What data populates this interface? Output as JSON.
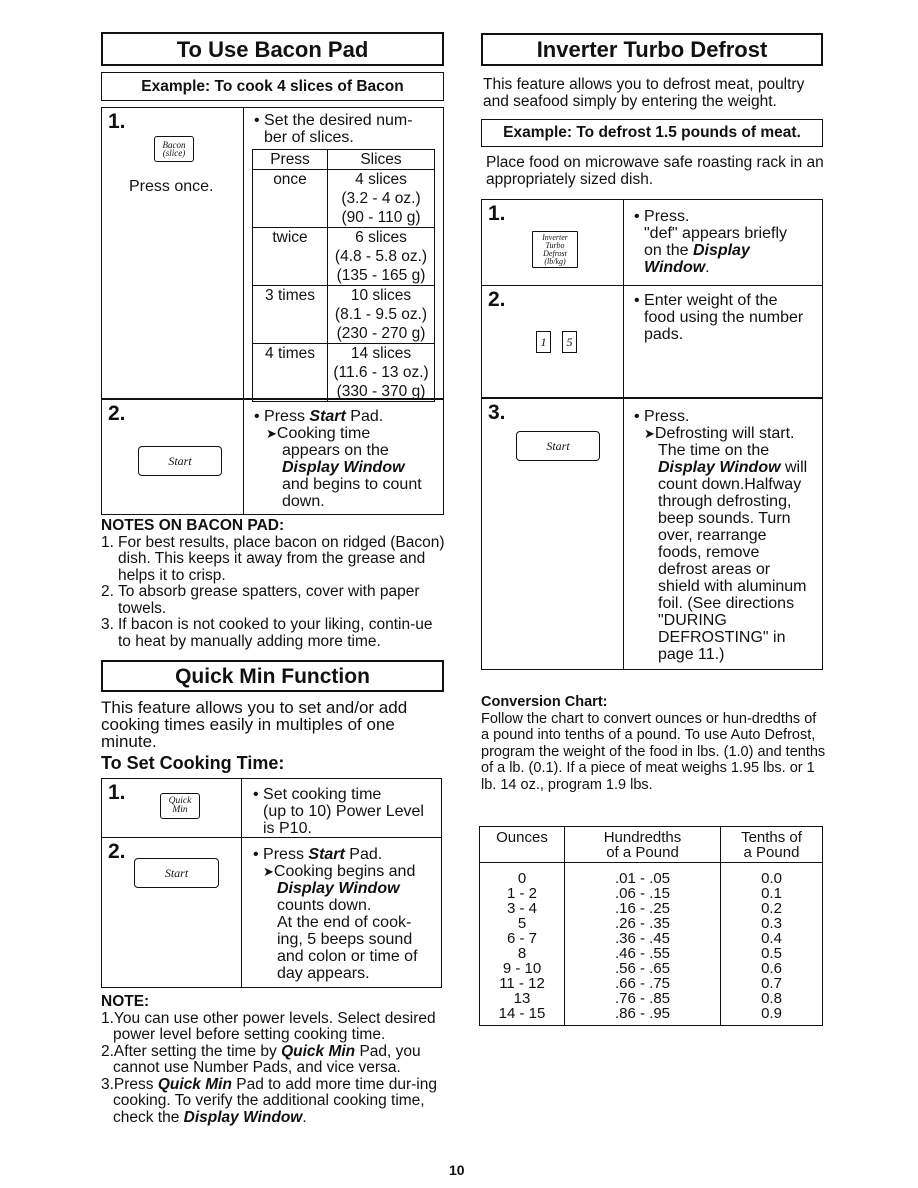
{
  "page_number": "10",
  "bacon": {
    "title": "To Use Bacon Pad",
    "example": "Example:  To cook 4 slices of Bacon",
    "step1": {
      "number": "1.",
      "pad_label_line1": "Bacon",
      "pad_label_line2": "(slice)",
      "press_note": "Press once.",
      "instruction_line1": "• Set the desired num-",
      "instruction_line2": "ber of slices.",
      "table": {
        "headers": [
          "Press",
          "Slices"
        ],
        "rows": [
          {
            "press": "once",
            "slices": "4 slices",
            "oz": "(3.2 - 4 oz.)",
            "g": "(90 - 110 g)"
          },
          {
            "press": "twice",
            "slices": "6 slices",
            "oz": "(4.8 - 5.8 oz.)",
            "g": "(135 - 165 g)"
          },
          {
            "press": "3 times",
            "slices": "10 slices",
            "oz": "(8.1 - 9.5 oz.)",
            "g": "(230 - 270 g)"
          },
          {
            "press": "4 times",
            "slices": "14 slices",
            "oz": "(11.6 - 13 oz.)",
            "g": "(330 - 370 g)"
          }
        ]
      }
    },
    "step2": {
      "number": "2.",
      "pad_label": "Start",
      "line1_pre": "• Press ",
      "line1_bold": "Start",
      "line1_post": " Pad.",
      "arrow": "➤",
      "line2": "Cooking time",
      "line3": "appears on the",
      "line4_bold": "Display Window",
      "line5": "and begins to count",
      "line6": "down."
    },
    "notes": {
      "heading": "NOTES ON BACON PAD:",
      "items": [
        {
          "num": "1.",
          "text": "For best results, place bacon on ridged (Bacon) dish. This keeps it away from the grease and helps it to crisp."
        },
        {
          "num": "2.",
          "text": "To absorb grease spatters, cover with paper towels."
        },
        {
          "num": "3.",
          "text": "If bacon is not cooked to your liking, contin-ue to heat by manually adding more time."
        }
      ]
    }
  },
  "quickmin": {
    "title": "Quick Min Function",
    "intro": "This feature allows you to set and/or add cooking times easily in multiples of one minute.",
    "subheading": "To Set Cooking Time:",
    "step1": {
      "number": "1.",
      "pad_label_line1": "Quick",
      "pad_label_line2": "Min",
      "line1": "• Set cooking time",
      "line2": "(up to 10) Power Level",
      "line3": "is P10."
    },
    "step2": {
      "number": "2.",
      "pad_label": "Start",
      "line1_pre": "• Press ",
      "line1_bold": "Start",
      "line1_post": " Pad.",
      "arrow": "➤",
      "line2": "Cooking begins and",
      "line3_bold": "Display Window",
      "line4": "counts down.",
      "line5": "At the end of cook-",
      "line6": "ing, 5 beeps sound",
      "line7": "and colon or time of",
      "line8": "day appears."
    },
    "note": {
      "heading": "NOTE:",
      "item1": "1.You can use other power levels. Select desired power level before setting cooking time.",
      "item2_pre": "2.After setting the time by ",
      "item2_bold": "Quick Min",
      "item2_post": " Pad, you cannot use Number Pads, and vice versa.",
      "item3_pre": "3.Press ",
      "item3_bold": "Quick Min",
      "item3_mid": " Pad to add more time dur-ing cooking. To verify the additional cooking time, check the ",
      "item3_bold2": "Display Window",
      "item3_post": "."
    }
  },
  "defrost": {
    "title": "Inverter Turbo Defrost",
    "intro": "This feature allows you to defrost meat, poultry and seafood simply by entering the weight.",
    "example": "Example:  To defrost 1.5 pounds of meat.",
    "placement": "Place food on microwave safe roasting rack in an appropriately sized dish.",
    "step1": {
      "number": "1.",
      "pad_lines": [
        "Inverter",
        "Turbo",
        "Defrost",
        "(lb/kg)"
      ],
      "line1": "• Press.",
      "line2": "\"def\" appears briefly",
      "line3_pre": "on the ",
      "line3_bold": "Display",
      "line4_bold": "Window",
      "line4_post": "."
    },
    "step2": {
      "number": "2.",
      "pads": [
        "1",
        "5"
      ],
      "line1": "• Enter weight of the",
      "line2": "food using the number",
      "line3": "pads."
    },
    "step3": {
      "number": "3.",
      "pad_label": "Start",
      "line1": "• Press.",
      "arrow": "➤",
      "line2": "Defrosting will start.",
      "line3": "The time on the",
      "line4_bold": "Display Window",
      "line4_post": " will",
      "lines_rest": [
        "count down.Halfway",
        "through defrosting,",
        "beep sounds. Turn",
        "over, rearrange",
        "foods, remove",
        "defrost areas or",
        "shield with aluminum",
        "foil. (See directions",
        "\"DURING",
        "DEFROSTING\" in",
        "page 11.)"
      ]
    },
    "conversion": {
      "heading": "Conversion Chart:",
      "text": "Follow the chart to convert ounces or hun-dredths of a pound into tenths of a pound.  To use Auto Defrost, program the weight of the food in lbs. (1.0) and tenths of a lb. (0.1).  If a piece of meat weighs 1.95 lbs. or 1 lb. 14 oz., program 1.9 lbs.",
      "headers": [
        {
          "line1": "Ounces",
          "line2": ""
        },
        {
          "line1": "Hundredths",
          "line2": "of a Pound"
        },
        {
          "line1": "Tenths of",
          "line2": "a Pound"
        }
      ],
      "rows": [
        [
          "0",
          ".01 - .05",
          "0.0"
        ],
        [
          "1 - 2",
          ".06 - .15",
          "0.1"
        ],
        [
          "3 - 4",
          ".16 - .25",
          "0.2"
        ],
        [
          "5",
          ".26 - .35",
          "0.3"
        ],
        [
          "6 - 7",
          ".36 - .45",
          "0.4"
        ],
        [
          "8",
          ".46 - .55",
          "0.5"
        ],
        [
          "9 - 10",
          ".56 - .65",
          "0.6"
        ],
        [
          "11 - 12",
          ".66 - .75",
          "0.7"
        ],
        [
          "13",
          ".76 - .85",
          "0.8"
        ],
        [
          "14 - 15",
          ".86 - .95",
          "0.9"
        ]
      ]
    }
  }
}
